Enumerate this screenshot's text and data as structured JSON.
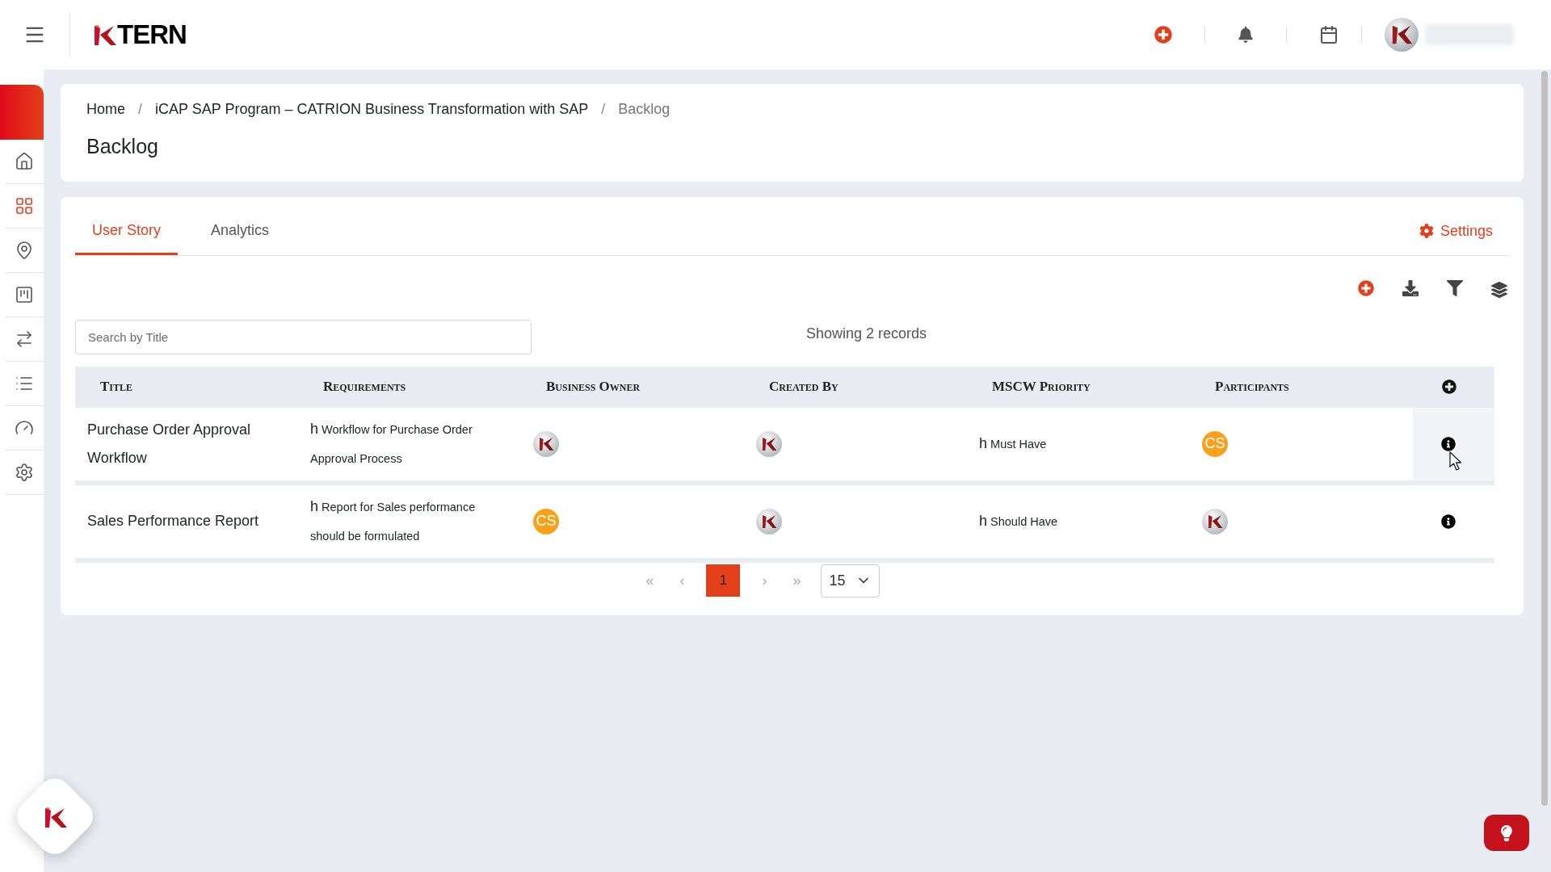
{
  "header": {
    "logo_text": "TERN"
  },
  "sidebar": {
    "items": [
      {
        "kind": "home",
        "selected": false
      },
      {
        "kind": "grid",
        "selected": true
      },
      {
        "kind": "pin",
        "selected": false
      },
      {
        "kind": "board",
        "selected": false
      },
      {
        "kind": "swap",
        "selected": false
      },
      {
        "kind": "list",
        "selected": false
      },
      {
        "kind": "gauge",
        "selected": false
      },
      {
        "kind": "gear",
        "selected": false
      }
    ]
  },
  "breadcrumb": [
    {
      "label": "Home",
      "current": false
    },
    {
      "label": "iCAP SAP Program – CATRION Business Transformation with SAP",
      "current": false
    },
    {
      "label": "Backlog",
      "current": true
    }
  ],
  "breadcrumb_separator": "/",
  "page_title": "Backlog",
  "tabs": [
    {
      "label": "User Story",
      "selected": true
    },
    {
      "label": "Analytics",
      "selected": false
    }
  ],
  "settings_link": "Settings",
  "search": {
    "placeholder": "Search by Title"
  },
  "record_count": "Showing 2 records",
  "table": {
    "columns": [
      "Title",
      "Requirements",
      "Business Owner",
      "Created By",
      "MSCW Priority",
      "Participants"
    ],
    "rows": [
      {
        "title": "Purchase Order Approval Workflow",
        "requirement": {
          "prefix": "h",
          "text": "Workflow for Purchase Order Approval Process"
        },
        "business_owner": {
          "kind": "logo"
        },
        "created_by": {
          "kind": "logo"
        },
        "priority": {
          "prefix": "h",
          "text": "Must Have"
        },
        "participants": {
          "kind": "initials",
          "initials": "CS"
        },
        "hovered": true
      },
      {
        "title": "Sales Performance Report",
        "requirement": {
          "prefix": "h",
          "text": "Report for Sales performance should be formulated"
        },
        "business_owner": {
          "kind": "initials",
          "initials": "CS"
        },
        "created_by": {
          "kind": "logo"
        },
        "priority": {
          "prefix": "h",
          "text": "Should Have"
        },
        "participants": {
          "kind": "logo"
        },
        "hovered": false
      }
    ]
  },
  "pagination": {
    "first": "«",
    "prev": "‹",
    "pages": [
      {
        "label": "1",
        "selected": true
      }
    ],
    "next": "›",
    "last": "»",
    "page_size": "15"
  }
}
